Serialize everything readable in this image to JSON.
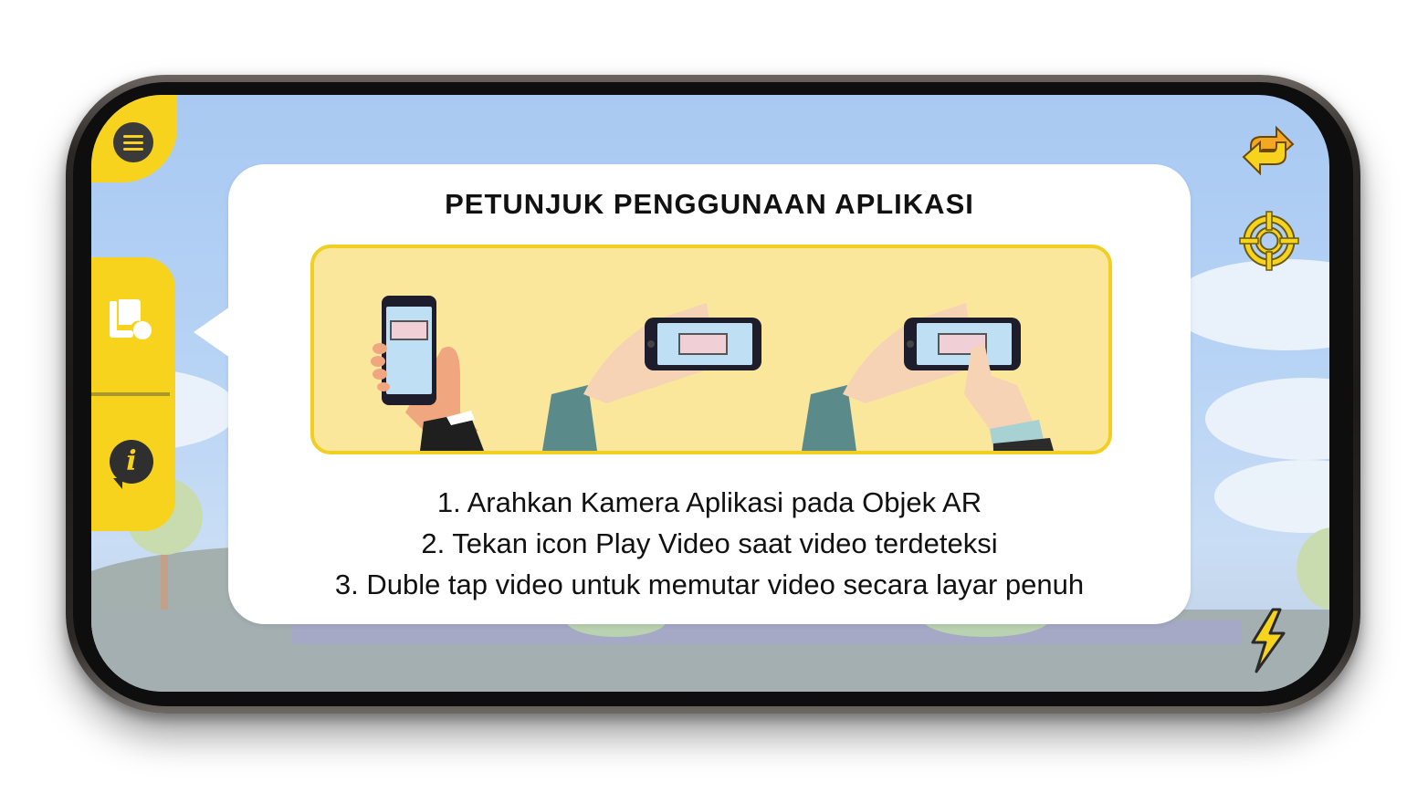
{
  "dialog": {
    "title": "PETUNJUK PENGGUNAAN APLIKASI",
    "steps": [
      "1. Arahkan Kamera Aplikasi pada Objek AR",
      "2. Tekan icon Play Video saat video terdeteksi",
      "3. Duble tap video untuk memutar video secara layar penuh"
    ]
  },
  "icons": {
    "menu": "hamburger-menu-icon",
    "library": "book-library-icon",
    "info": "info-icon",
    "switch_camera": "switch-camera-icon",
    "focus": "crosshair-focus-icon",
    "flash": "lightning-flash-icon"
  },
  "info_glyph": "i",
  "colors": {
    "accent_yellow": "#f7d31e",
    "illustration_bg": "#fbe79b",
    "illustration_border": "#f1cf22",
    "sky": "#a9c9f2",
    "dialog_bg": "#ffffff"
  }
}
